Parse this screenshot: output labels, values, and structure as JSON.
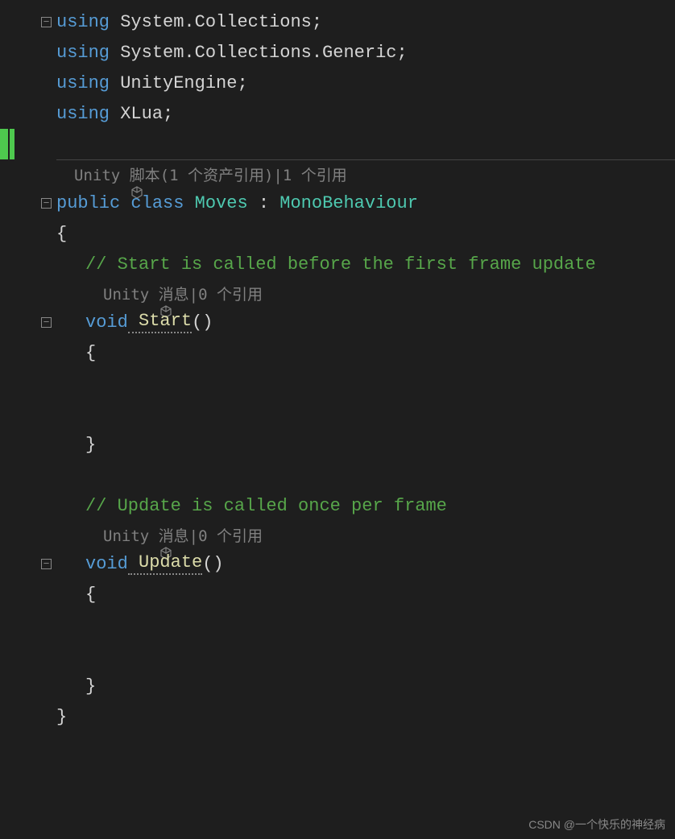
{
  "code": {
    "using1_kw": "using",
    "using1_ns": " System.Collections;",
    "using2_kw": "using",
    "using2_ns": " System.Collections.Generic;",
    "using3_kw": "using",
    "using3_ns": " UnityEngine;",
    "using4_kw": "using",
    "using4_ns": " XLua;",
    "codelens_class": "Unity 脚本(1 个资产引用)|1 个引用",
    "public_kw": "public",
    "class_kw": " class",
    "class_name": " Moves",
    "colon": " : ",
    "base_class": "MonoBehaviour",
    "open_brace": "{",
    "comment_start": "// Start is called before the first frame update",
    "codelens_start": "Unity 消息|0 个引用",
    "void_kw1": "void",
    "start_name": " Start",
    "parens1": "()",
    "brace_open1": "{",
    "brace_close1": "}",
    "comment_update": "// Update is called once per frame",
    "codelens_update": "Unity 消息|0 个引用",
    "void_kw2": "void",
    "update_name": " Update",
    "parens2": "()",
    "brace_open2": "{",
    "brace_close2": "}",
    "close_brace": "}"
  },
  "watermark": "CSDN @一个快乐的神经病"
}
